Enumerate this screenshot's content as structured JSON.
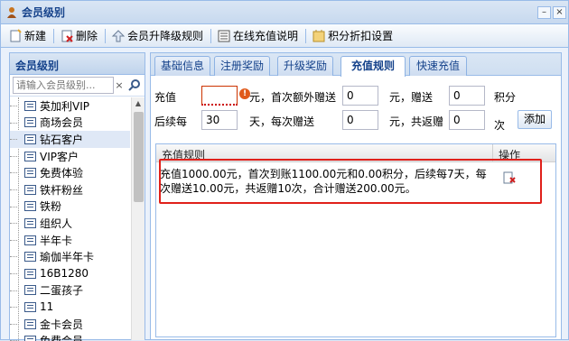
{
  "window": {
    "title": "会员级别"
  },
  "toolbar": {
    "new_label": "新建",
    "delete_label": "删除",
    "upgrade_rule_label": "会员升降级规则",
    "recharge_help_label": "在线充值说明",
    "points_label": "积分折扣设置"
  },
  "left_panel": {
    "title": "会员级别",
    "search_placeholder": "请输入会员级别...",
    "clear_glyph": "×",
    "items": [
      {
        "label": "英加利VIP"
      },
      {
        "label": "商场会员"
      },
      {
        "label": "钻石客户",
        "selected": true
      },
      {
        "label": "VIP客户"
      },
      {
        "label": "免费体验"
      },
      {
        "label": "铁杆粉丝"
      },
      {
        "label": "铁粉"
      },
      {
        "label": "组织人"
      },
      {
        "label": "半年卡"
      },
      {
        "label": "瑜伽半年卡"
      },
      {
        "label": "16B1280"
      },
      {
        "label": "二蛋孩子"
      },
      {
        "label": "11"
      },
      {
        "label": "金卡会员"
      },
      {
        "label": "免费会员"
      }
    ]
  },
  "tabs": [
    {
      "label": "基础信息"
    },
    {
      "label": "注册奖励"
    },
    {
      "label": "升级奖励"
    },
    {
      "label": "充值规则",
      "active": true
    },
    {
      "label": "快速充值"
    }
  ],
  "form": {
    "recharge_label": "充值",
    "recharge_value": "",
    "unit_yuan_first_gift": "元，首次额外赠送",
    "first_gift_value": "0",
    "unit_yuan_gift": "元，赠送",
    "points_value": "0",
    "points_label": "积分",
    "follow_label": "后续每",
    "days_value": "30",
    "days_each_gift": "天，每次赠送",
    "each_gift_value": "0",
    "unit_yuan_total": "元，共返赠",
    "times_value": "0",
    "times_label": "次",
    "add_button": "添加"
  },
  "grid": {
    "col_rule": "充值规则",
    "col_action": "操作",
    "rows": [
      {
        "rule": "充值1000.00元，首次到账1100.00元和0.00积分，后续每7天，每次赠送10.00元，共返赠10次，合计赠送200.00元。"
      }
    ]
  },
  "colors": {
    "accent": "#15428b",
    "highlight_border": "#e0201a"
  }
}
